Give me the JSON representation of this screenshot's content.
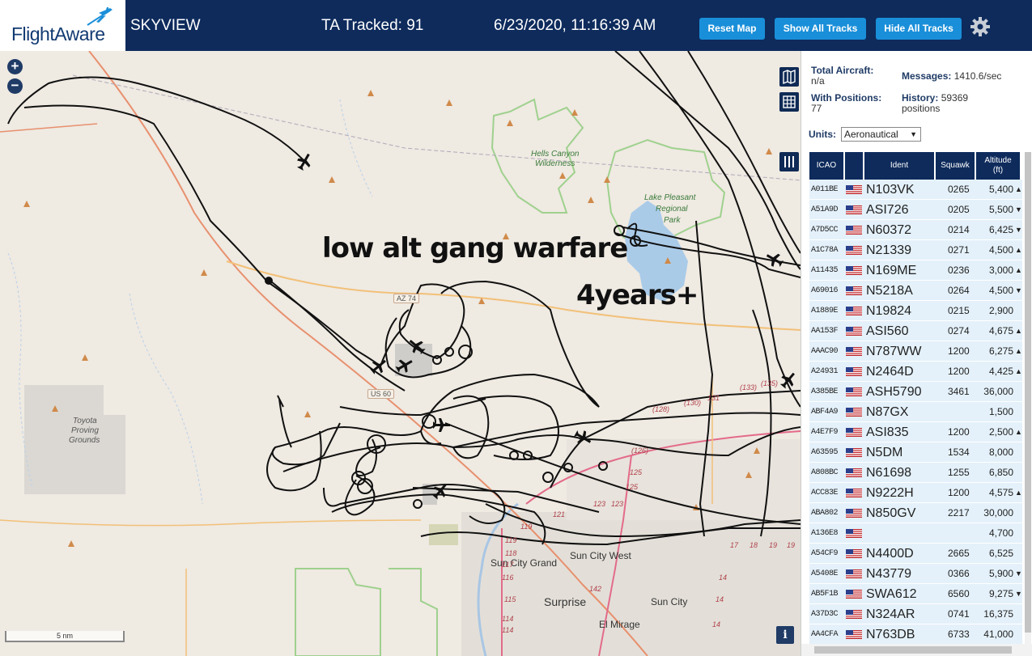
{
  "header": {
    "logo": "FlightAware",
    "title": "SKYVIEW",
    "tracked": "TA Tracked: 91",
    "datetime": "6/23/2020, 11:16:39 AM",
    "buttons": {
      "reset": "Reset Map",
      "show": "Show All Tracks",
      "hide": "Hide All Tracks"
    }
  },
  "map": {
    "annotations": [
      "low alt gang warfare",
      "4years+"
    ],
    "labels": {
      "hells_canyon": "Hells Canyon",
      "wilderness": "Wilderness",
      "lake_pleasant": "Lake Pleasant",
      "regional": "Regional",
      "park": "Park",
      "toyota": "Toyota",
      "proving": "Proving",
      "grounds": "Grounds",
      "sun_city_grand": "Sun City Grand",
      "sun_city_west": "Sun City West",
      "surprise": "Surprise",
      "sun_city": "Sun City",
      "el_mirage": "El Mirage",
      "az74": "AZ 74",
      "us60": "US 60"
    },
    "road_labels": [
      "(128)",
      "(130)",
      "131",
      "(133)",
      "(135)",
      "(126)",
      "125",
      "125",
      "123",
      "123",
      "121",
      "119",
      "119",
      "118",
      "117",
      "116",
      "115",
      "114",
      "114",
      "142",
      "17",
      "18",
      "19",
      "19",
      "14",
      "14",
      "14"
    ],
    "scale": "5 nm",
    "info": "i"
  },
  "panel": {
    "total_aircraft_label": "Total Aircraft:",
    "total_aircraft_value": "n/a",
    "with_positions_label": "With Positions:",
    "with_positions_value": "77",
    "messages_label": "Messages:",
    "messages_value": "1410.6/sec",
    "history_label": "History:",
    "history_value": "59369",
    "history_unit": "positions",
    "units_label": "Units:",
    "units_value": "Aeronautical",
    "columns": [
      "ICAO",
      "Ident",
      "Squawk",
      "Altitude",
      "(ft)"
    ],
    "rows": [
      {
        "icao": "A011BE",
        "ident": "N103VK",
        "squawk": "0265",
        "alt": "5,400",
        "trend": "▲"
      },
      {
        "icao": "A51A9D",
        "ident": "ASI726",
        "squawk": "0205",
        "alt": "5,500",
        "trend": "▼"
      },
      {
        "icao": "A7D5CC",
        "ident": "N60372",
        "squawk": "0214",
        "alt": "6,425",
        "trend": "▼"
      },
      {
        "icao": "A1C78A",
        "ident": "N21339",
        "squawk": "0271",
        "alt": "4,500",
        "trend": "▲"
      },
      {
        "icao": "A11435",
        "ident": "N169ME",
        "squawk": "0236",
        "alt": "3,000",
        "trend": "▲"
      },
      {
        "icao": "A69016",
        "ident": "N5218A",
        "squawk": "0264",
        "alt": "4,500",
        "trend": "▼"
      },
      {
        "icao": "A1889E",
        "ident": "N19824",
        "squawk": "0215",
        "alt": "2,900",
        "trend": ""
      },
      {
        "icao": "AA153F",
        "ident": "ASI560",
        "squawk": "0274",
        "alt": "4,675",
        "trend": "▲"
      },
      {
        "icao": "AAAC90",
        "ident": "N787WW",
        "squawk": "1200",
        "alt": "6,275",
        "trend": "▲"
      },
      {
        "icao": "A24931",
        "ident": "N2464D",
        "squawk": "1200",
        "alt": "4,425",
        "trend": "▲"
      },
      {
        "icao": "A385BE",
        "ident": "ASH5790",
        "squawk": "3461",
        "alt": "36,000",
        "trend": ""
      },
      {
        "icao": "ABF4A9",
        "ident": "N87GX",
        "squawk": "",
        "alt": "1,500",
        "trend": ""
      },
      {
        "icao": "A4E7F9",
        "ident": "ASI835",
        "squawk": "1200",
        "alt": "2,500",
        "trend": "▲"
      },
      {
        "icao": "A63595",
        "ident": "N5DM",
        "squawk": "1534",
        "alt": "8,000",
        "trend": ""
      },
      {
        "icao": "A808BC",
        "ident": "N61698",
        "squawk": "1255",
        "alt": "6,850",
        "trend": ""
      },
      {
        "icao": "ACC83E",
        "ident": "N9222H",
        "squawk": "1200",
        "alt": "4,575",
        "trend": "▲"
      },
      {
        "icao": "ABA802",
        "ident": "N850GV",
        "squawk": "2217",
        "alt": "30,000",
        "trend": ""
      },
      {
        "icao": "A136E8",
        "ident": "",
        "squawk": "",
        "alt": "4,700",
        "trend": ""
      },
      {
        "icao": "A54CF9",
        "ident": "N4400D",
        "squawk": "2665",
        "alt": "6,525",
        "trend": ""
      },
      {
        "icao": "A5408E",
        "ident": "N43779",
        "squawk": "0366",
        "alt": "5,900",
        "trend": "▼"
      },
      {
        "icao": "AB5F1B",
        "ident": "SWA612",
        "squawk": "6560",
        "alt": "9,275",
        "trend": "▼"
      },
      {
        "icao": "A37D3C",
        "ident": "N324AR",
        "squawk": "0741",
        "alt": "16,375",
        "trend": ""
      },
      {
        "icao": "AA4CFA",
        "ident": "N763DB",
        "squawk": "6733",
        "alt": "41,000",
        "trend": ""
      }
    ]
  },
  "icons": {
    "gear": "gear-icon",
    "map_layers": "map-icon",
    "grid": "grid-icon",
    "columns": "columns-icon",
    "flag": "us-flag-icon",
    "plane": "airplane-icon"
  },
  "colors": {
    "header_bg": "#0e2b5c",
    "button_bg": "#1a8fd9",
    "row_bg": "#e4f1fa",
    "map_bg": "#efeae2"
  }
}
